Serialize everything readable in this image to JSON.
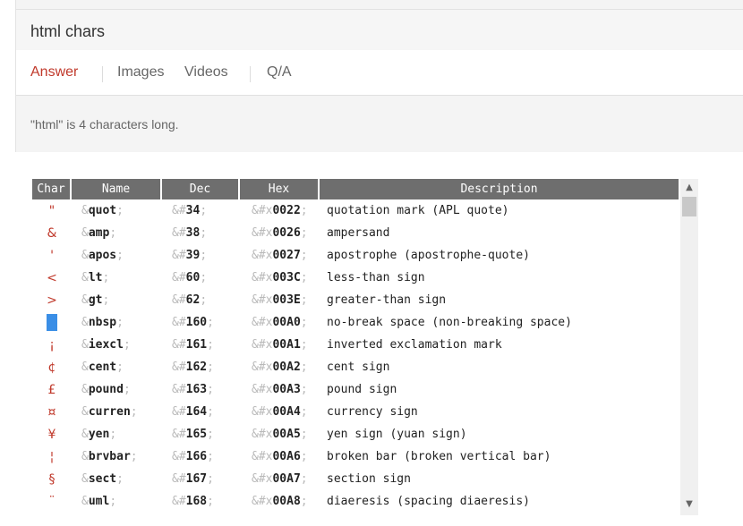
{
  "search": {
    "value": "html chars"
  },
  "tabs": [
    {
      "label": "Answer",
      "active": true
    },
    {
      "label": "Images",
      "active": false
    },
    {
      "label": "Videos",
      "active": false
    },
    {
      "label": "Q/A",
      "active": false
    }
  ],
  "answer": {
    "text": "\"html\" is 4 characters long."
  },
  "table": {
    "headers": [
      "Char",
      "Name",
      "Dec",
      "Hex",
      "Description"
    ],
    "rows": [
      {
        "char": "\"",
        "name": "quot",
        "dec": "34",
        "hex": "0022",
        "desc": "quotation mark (APL quote)"
      },
      {
        "char": "&",
        "name": "amp",
        "dec": "38",
        "hex": "0026",
        "desc": "ampersand"
      },
      {
        "char": "'",
        "name": "apos",
        "dec": "39",
        "hex": "0027",
        "desc": "apostrophe (apostrophe-quote)"
      },
      {
        "char": "<",
        "name": "lt",
        "dec": "60",
        "hex": "003C",
        "desc": "less-than sign"
      },
      {
        "char": ">",
        "name": "gt",
        "dec": "62",
        "hex": "003E",
        "desc": "greater-than sign"
      },
      {
        "char": "",
        "name": "nbsp",
        "dec": "160",
        "hex": "00A0",
        "desc": "no-break space (non-breaking space)",
        "highlight": true
      },
      {
        "char": "¡",
        "name": "iexcl",
        "dec": "161",
        "hex": "00A1",
        "desc": "inverted exclamation mark"
      },
      {
        "char": "¢",
        "name": "cent",
        "dec": "162",
        "hex": "00A2",
        "desc": "cent sign"
      },
      {
        "char": "£",
        "name": "pound",
        "dec": "163",
        "hex": "00A3",
        "desc": "pound sign"
      },
      {
        "char": "¤",
        "name": "curren",
        "dec": "164",
        "hex": "00A4",
        "desc": "currency sign"
      },
      {
        "char": "¥",
        "name": "yen",
        "dec": "165",
        "hex": "00A5",
        "desc": "yen sign (yuan sign)"
      },
      {
        "char": "¦",
        "name": "brvbar",
        "dec": "166",
        "hex": "00A6",
        "desc": "broken bar (broken vertical bar)"
      },
      {
        "char": "§",
        "name": "sect",
        "dec": "167",
        "hex": "00A7",
        "desc": "section sign"
      },
      {
        "char": "¨",
        "name": "uml",
        "dec": "168",
        "hex": "00A8",
        "desc": "diaeresis (spacing diaeresis)"
      }
    ]
  },
  "scrollbar": {
    "up_glyph": "▲",
    "down_glyph": "▼"
  },
  "colors": {
    "accent": "#c0392b",
    "header_bg": "#6e6e6e",
    "nbsp_highlight": "#3a8ee6"
  }
}
